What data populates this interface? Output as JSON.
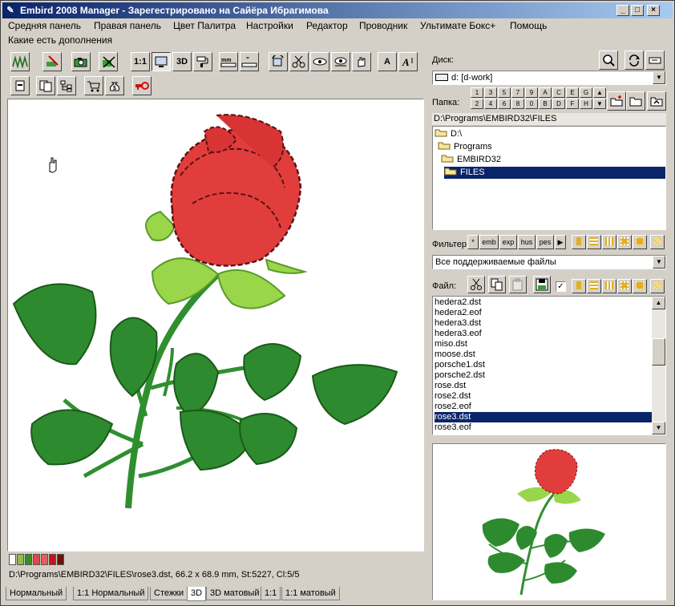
{
  "titlebar": {
    "title": "Embird 2008 Manager - Зарегестрировано на Сайёра Ибрагимова",
    "minimize": "_",
    "maximize": "□",
    "close": "×"
  },
  "menu": {
    "row1": [
      "Средняя панель",
      "Правая панель",
      "Цвет Палитра",
      "Настройки",
      "Редактор",
      "Проводник",
      "Ультимате Бокс+",
      "Помощь"
    ],
    "row2": [
      "Какие есть дополнения"
    ]
  },
  "toolbar": {
    "btn_1to1": "1:1",
    "btn_3d": "3D",
    "btn_text_a": "A"
  },
  "canvas": {
    "palette": [
      "#ffffff",
      "#8fbf3f",
      "#3a8a2a",
      "#e04848",
      "#e06060",
      "#c01818",
      "#6a1010"
    ],
    "status": "D:\\Programs\\EMBIRD32\\FILES\\rose3.dst, 66.2 x 68.9 mm, St:5227, Cl:5/5"
  },
  "tabs": [
    "Нормальный",
    "1:1 Нормальный",
    "Стежки",
    "3D",
    "3D матовый",
    "1:1",
    "1:1 матовый"
  ],
  "active_tab": "3D",
  "right_panel": {
    "disk_label": "Диск:",
    "disk_value": "d: [d-work]",
    "folder_label": "Папка:",
    "folder_buttons_row1": [
      "1",
      "3",
      "5",
      "7",
      "9",
      "A",
      "C",
      "E",
      "G"
    ],
    "folder_buttons_row2": [
      "2",
      "4",
      "6",
      "8",
      "0",
      "B",
      "D",
      "F",
      "H"
    ],
    "path": "D:\\Programs\\EMBIRD32\\FILES",
    "tree": [
      {
        "label": "D:\\",
        "selected": false
      },
      {
        "label": "Programs",
        "selected": false
      },
      {
        "label": "EMBIRD32",
        "selected": false
      },
      {
        "label": "FILES",
        "selected": true
      }
    ],
    "filter_label": "Фильтер",
    "filter_buttons": [
      "*",
      "emb",
      "exp",
      "hus",
      "pes"
    ],
    "filter_value": "Все поддерживаемые файлы",
    "file_label": "Файл:",
    "files": [
      "hedera2.dst",
      "hedera2.eof",
      "hedera3.dst",
      "hedera3.eof",
      "miso.dst",
      "moose.dst",
      "porsche1.dst",
      "porsche2.dst",
      "rose.dst",
      "rose2.dst",
      "rose2.eof",
      "rose3.dst",
      "rose3.eof"
    ],
    "selected_file": "rose3.dst"
  },
  "colors": {
    "title_start": "#0a246a",
    "title_end": "#a6caf0",
    "selection": "#0a246a",
    "window_bg": "#d4d0c8"
  }
}
